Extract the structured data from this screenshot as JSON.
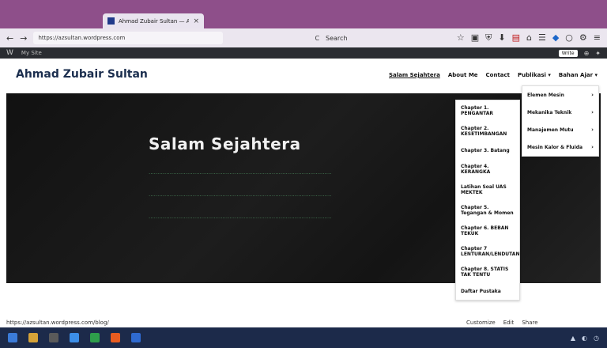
{
  "browser": {
    "tab_title": "Ahmad Zubair Sultan — Arts",
    "tab_close": "×",
    "url": "https://azsultan.wordpress.com",
    "search_placeholder": "Search",
    "nav": {
      "back": "←",
      "forward": "→",
      "reload": "C"
    },
    "toolbar_icons": [
      "☆",
      "▣",
      "⛨",
      "⬇",
      "▤",
      "⌂",
      "☰",
      "◆",
      "○",
      "⚙",
      "≡"
    ]
  },
  "admin_bar": {
    "wp_logo": "W",
    "site": "My Site",
    "write_label": "Write",
    "icons": [
      "⊕",
      "✦"
    ]
  },
  "site": {
    "title": "Ahmad Zubair Sultan",
    "menu": [
      "Salam Sejahtera",
      "About Me",
      "Contact",
      "Publikasi ▾",
      "Bahan Ajar ▾"
    ]
  },
  "hero": {
    "title": "Salam Sejahtera",
    "lines": [
      "........................................................................................................",
      "........................................................................................................",
      "........................................................................................................"
    ]
  },
  "dropdown_bahan_ajar": [
    "Elemen Mesin",
    "Mekanika Teknik",
    "Manajemen Mutu",
    "Mesin Kalor & Fluida"
  ],
  "dropdown_mekanika_teknik": [
    "Chapter 1. PENGANTAR",
    "Chapter 2. KESETIMBANGAN",
    "Chapter 3. Batang",
    "Chapter 4. KERANGKA",
    "Latihan Soal UAS MEKTEK",
    "Chapter 5. Tegangan & Momen",
    "Chapter 6. BEBAN TEKUK",
    "Chapter 7 LENTURAN/LENDUTAN",
    "Chapter 8. STATIS TAK TENTU",
    "Daftar Pustaka"
  ],
  "status_url": "https://azsultan.wordpress.com/blog/",
  "bottom_bar": [
    "Customize",
    "Edit",
    "Share"
  ],
  "colors": {
    "tabstrip": "#8e4f8a",
    "site_title": "#1b2e4e",
    "hero_bg": "#151515",
    "hero_line": "#4b8a5e",
    "taskbar": "#1c2a4a"
  }
}
